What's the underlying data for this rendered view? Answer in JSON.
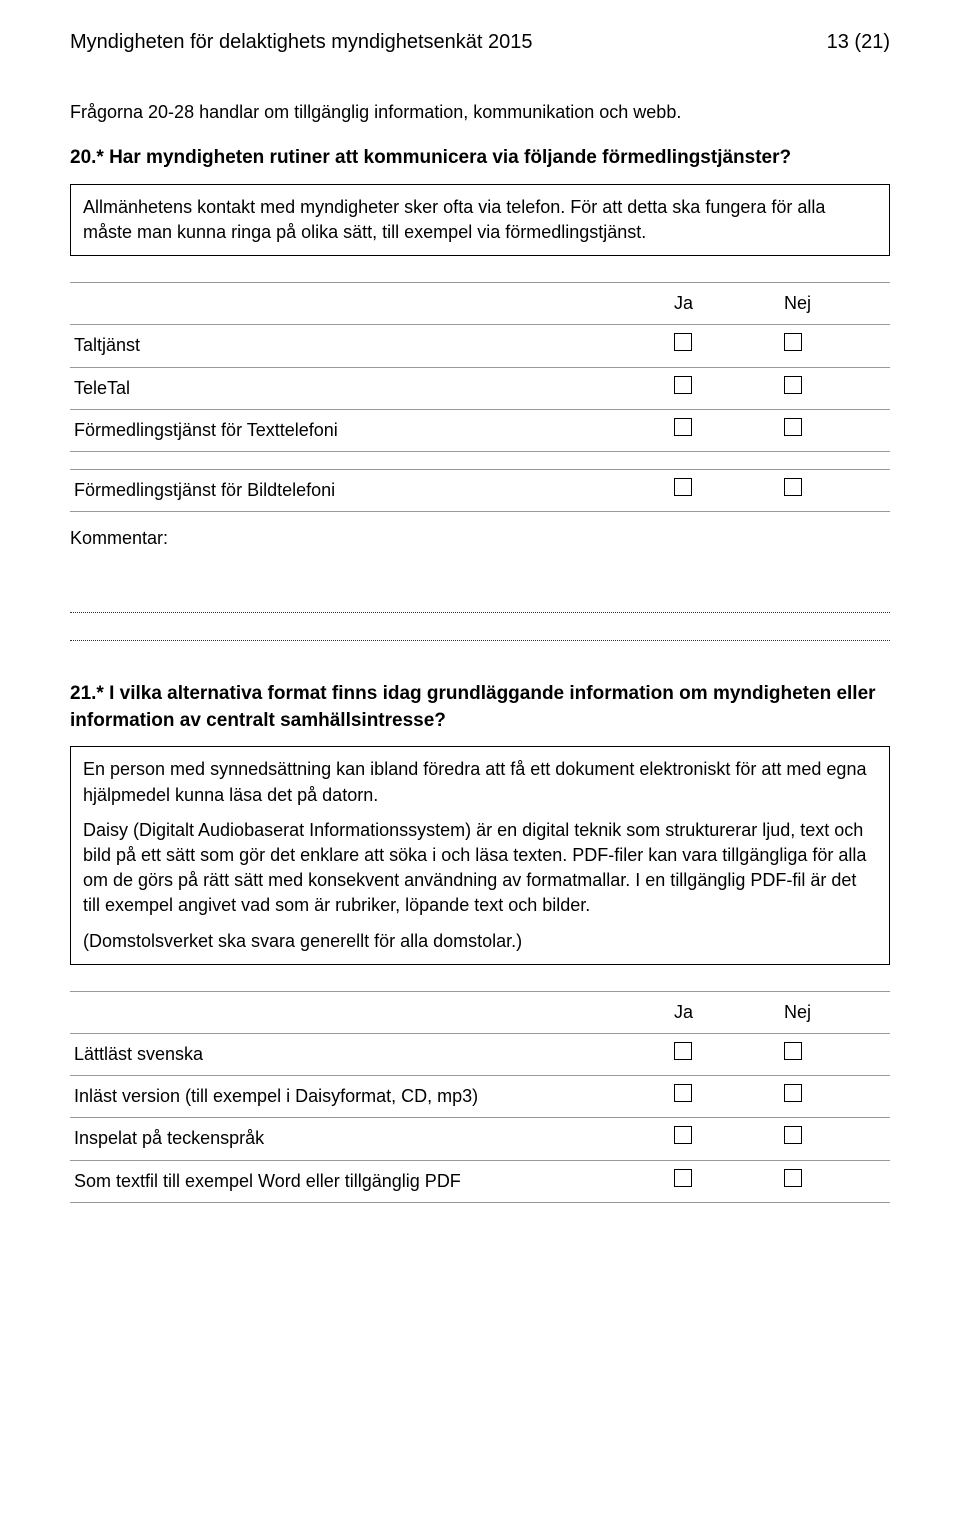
{
  "header": {
    "doc_title": "Myndigheten för delaktighets myndighetsenkät 2015",
    "page_indicator": "13 (21)"
  },
  "section_intro": "Frågorna 20-28 handlar om tillgänglig information, kommunikation och webb.",
  "q20": {
    "title": "20.* Har myndigheten rutiner att kommunicera via följande förmedlingstjänster?",
    "info": "Allmänhetens kontakt med myndigheter sker ofta via telefon. För att detta ska fungera för alla måste man kunna ringa på olika sätt, till exempel via förmedlingstjänst.",
    "col_yes": "Ja",
    "col_no": "Nej",
    "rows": {
      "r1": "Taltjänst",
      "r2": "TeleTal",
      "r3": "Förmedlingstjänst för Texttelefoni",
      "r4": "Förmedlingstjänst för Bildtelefoni"
    },
    "comment_label": "Kommentar:"
  },
  "q21": {
    "title": "21.* I vilka alternativa format finns idag grundläggande information om myndigheten eller information av centralt samhällsintresse?",
    "info_p1": "En person med synnedsättning kan ibland föredra att få ett dokument elektroniskt för att med egna hjälpmedel kunna läsa det på datorn.",
    "info_p2": "Daisy (Digitalt Audiobaserat Informationssystem) är en digital teknik som strukturerar ljud, text och bild på ett sätt som gör det enklare att söka i och läsa texten. PDF-filer kan vara tillgängliga för alla om de görs på rätt sätt med konsekvent användning av formatmallar. I en tillgänglig PDF-fil är det till exempel angivet vad som är rubriker, löpande text och bilder.",
    "info_p3": "(Domstolsverket ska svara generellt för alla domstolar.)",
    "col_yes": "Ja",
    "col_no": "Nej",
    "rows": {
      "r1": "Lättläst svenska",
      "r2": "Inläst version (till exempel i Daisyformat, CD, mp3)",
      "r3": "Inspelat på teckenspråk",
      "r4": "Som textfil till exempel Word eller tillgänglig PDF"
    }
  }
}
